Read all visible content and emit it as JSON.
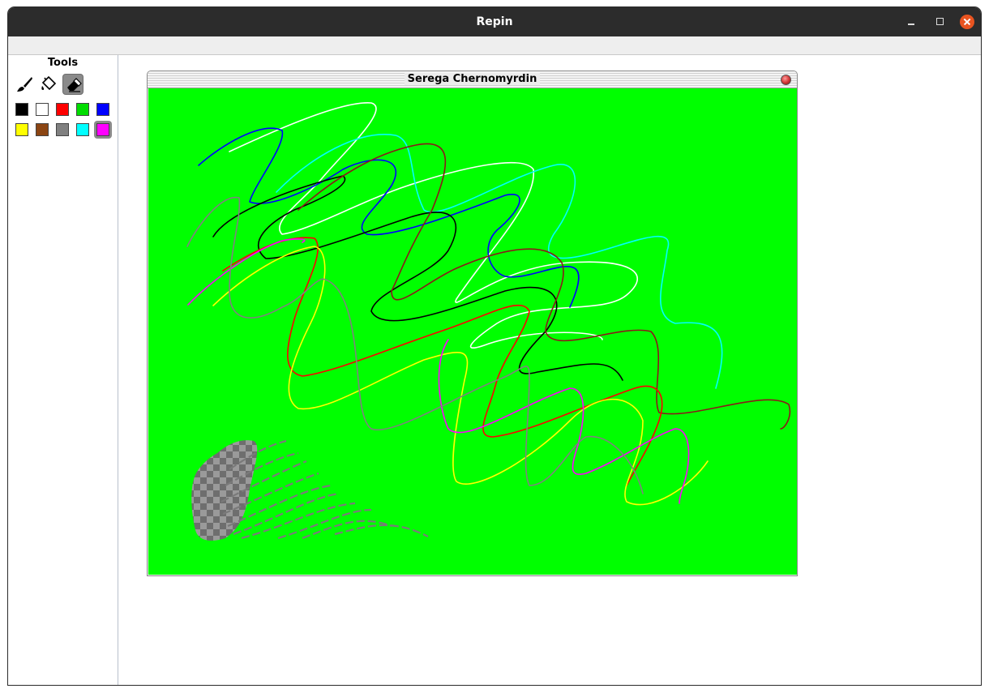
{
  "window": {
    "title": "Repin"
  },
  "tools_panel": {
    "heading": "Tools",
    "tools": [
      {
        "name": "brush",
        "icon": "brush-icon"
      },
      {
        "name": "fill",
        "icon": "paint-bucket-icon"
      },
      {
        "name": "eraser",
        "icon": "eraser-icon",
        "selected": true
      }
    ],
    "palette": [
      {
        "color": "#000000"
      },
      {
        "color": "#ffffff"
      },
      {
        "color": "#ff0000"
      },
      {
        "color": "#00dd00"
      },
      {
        "color": "#0000ff"
      },
      {
        "color": "#ffff00"
      },
      {
        "color": "#8b4513"
      },
      {
        "color": "#808080"
      },
      {
        "color": "#00ffff"
      },
      {
        "color": "#ff00ff",
        "selected": true
      }
    ]
  },
  "canvas_window": {
    "title": "Serega Chernomyrdin",
    "background_color": "#00ff00"
  }
}
